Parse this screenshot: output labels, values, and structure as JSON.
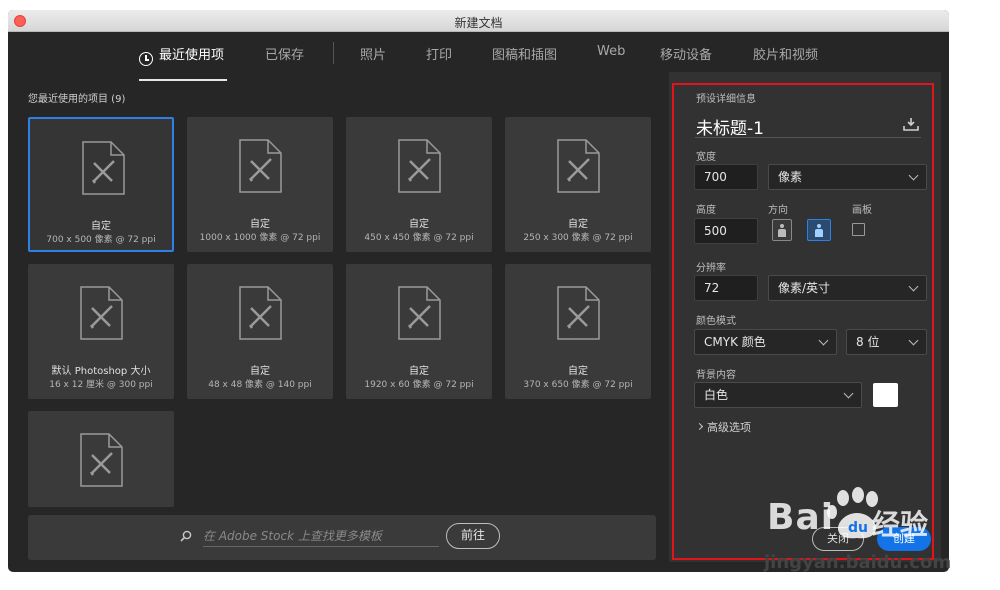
{
  "window": {
    "title": "新建文档"
  },
  "tabs": [
    {
      "label": "最近使用项",
      "active": true
    },
    {
      "label": "已保存"
    },
    {
      "label": "照片"
    },
    {
      "label": "打印"
    },
    {
      "label": "图稿和插图"
    },
    {
      "label": "Web"
    },
    {
      "label": "移动设备"
    },
    {
      "label": "胶片和视频"
    }
  ],
  "recent": {
    "title": "您最近使用的项目 (9)",
    "items": [
      {
        "title": "自定",
        "sub": "700 x 500 像素 @ 72 ppi",
        "selected": true
      },
      {
        "title": "自定",
        "sub": "1000 x 1000 像素 @ 72 ppi"
      },
      {
        "title": "自定",
        "sub": "450 x 450 像素 @ 72 ppi"
      },
      {
        "title": "自定",
        "sub": "250 x 300 像素 @ 72 ppi"
      },
      {
        "title": "默认 Photoshop 大小",
        "sub": "16 x 12 厘米 @ 300 ppi"
      },
      {
        "title": "自定",
        "sub": "48 x 48 像素 @ 140 ppi"
      },
      {
        "title": "自定",
        "sub": "1920 x 60 像素 @ 72 ppi"
      },
      {
        "title": "自定",
        "sub": "370 x 650 像素 @ 72 ppi"
      },
      {
        "title": "",
        "sub": ""
      }
    ]
  },
  "search": {
    "placeholder": "在 Adobe Stock 上查找更多模板",
    "go_label": "前往"
  },
  "details": {
    "section_label": "预设详细信息",
    "doc_name": "未标题-1",
    "width_label": "宽度",
    "width_value": "700",
    "width_unit": "像素",
    "height_label": "高度",
    "height_value": "500",
    "orientation_label": "方向",
    "artboard_label": "画板",
    "resolution_label": "分辨率",
    "resolution_value": "72",
    "resolution_unit": "像素/英寸",
    "color_mode_label": "颜色模式",
    "color_mode": "CMYK 颜色",
    "bit_depth": "8 位",
    "background_label": "背景内容",
    "background": "白色",
    "background_color": "#ffffff",
    "advanced_label": "高级选项"
  },
  "footer": {
    "close_label": "关闭",
    "create_label": "创建"
  },
  "watermark": {
    "brand": "Bai",
    "brand_suffix": "经验",
    "url": "jingyan.baidu.com"
  },
  "colors": {
    "accent": "#1473e6",
    "highlight": "#e1141c"
  }
}
